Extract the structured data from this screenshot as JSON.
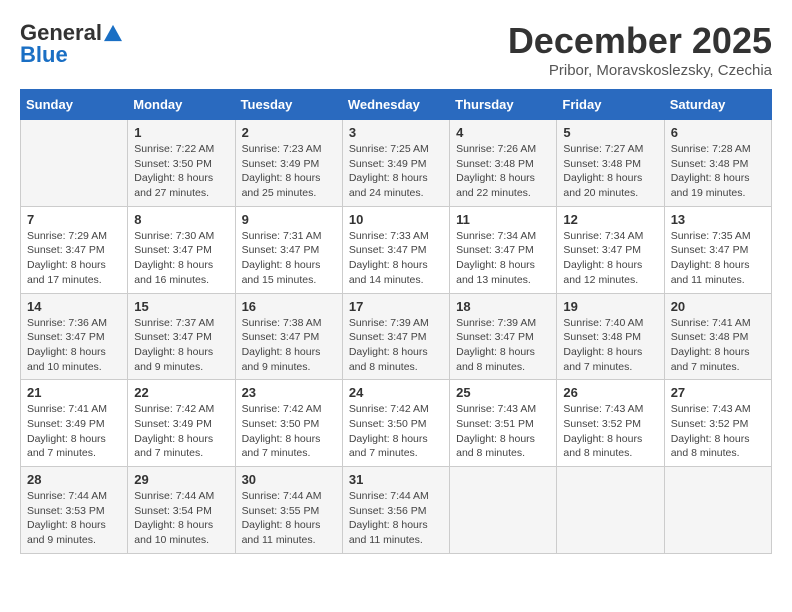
{
  "header": {
    "logo_line1": "General",
    "logo_line2": "Blue",
    "month_title": "December 2025",
    "location": "Pribor, Moravskoslezsky, Czechia"
  },
  "days_of_week": [
    "Sunday",
    "Monday",
    "Tuesday",
    "Wednesday",
    "Thursday",
    "Friday",
    "Saturday"
  ],
  "weeks": [
    [
      {
        "day": "",
        "info": ""
      },
      {
        "day": "1",
        "info": "Sunrise: 7:22 AM\nSunset: 3:50 PM\nDaylight: 8 hours\nand 27 minutes."
      },
      {
        "day": "2",
        "info": "Sunrise: 7:23 AM\nSunset: 3:49 PM\nDaylight: 8 hours\nand 25 minutes."
      },
      {
        "day": "3",
        "info": "Sunrise: 7:25 AM\nSunset: 3:49 PM\nDaylight: 8 hours\nand 24 minutes."
      },
      {
        "day": "4",
        "info": "Sunrise: 7:26 AM\nSunset: 3:48 PM\nDaylight: 8 hours\nand 22 minutes."
      },
      {
        "day": "5",
        "info": "Sunrise: 7:27 AM\nSunset: 3:48 PM\nDaylight: 8 hours\nand 20 minutes."
      },
      {
        "day": "6",
        "info": "Sunrise: 7:28 AM\nSunset: 3:48 PM\nDaylight: 8 hours\nand 19 minutes."
      }
    ],
    [
      {
        "day": "7",
        "info": "Sunrise: 7:29 AM\nSunset: 3:47 PM\nDaylight: 8 hours\nand 17 minutes."
      },
      {
        "day": "8",
        "info": "Sunrise: 7:30 AM\nSunset: 3:47 PM\nDaylight: 8 hours\nand 16 minutes."
      },
      {
        "day": "9",
        "info": "Sunrise: 7:31 AM\nSunset: 3:47 PM\nDaylight: 8 hours\nand 15 minutes."
      },
      {
        "day": "10",
        "info": "Sunrise: 7:33 AM\nSunset: 3:47 PM\nDaylight: 8 hours\nand 14 minutes."
      },
      {
        "day": "11",
        "info": "Sunrise: 7:34 AM\nSunset: 3:47 PM\nDaylight: 8 hours\nand 13 minutes."
      },
      {
        "day": "12",
        "info": "Sunrise: 7:34 AM\nSunset: 3:47 PM\nDaylight: 8 hours\nand 12 minutes."
      },
      {
        "day": "13",
        "info": "Sunrise: 7:35 AM\nSunset: 3:47 PM\nDaylight: 8 hours\nand 11 minutes."
      }
    ],
    [
      {
        "day": "14",
        "info": "Sunrise: 7:36 AM\nSunset: 3:47 PM\nDaylight: 8 hours\nand 10 minutes."
      },
      {
        "day": "15",
        "info": "Sunrise: 7:37 AM\nSunset: 3:47 PM\nDaylight: 8 hours\nand 9 minutes."
      },
      {
        "day": "16",
        "info": "Sunrise: 7:38 AM\nSunset: 3:47 PM\nDaylight: 8 hours\nand 9 minutes."
      },
      {
        "day": "17",
        "info": "Sunrise: 7:39 AM\nSunset: 3:47 PM\nDaylight: 8 hours\nand 8 minutes."
      },
      {
        "day": "18",
        "info": "Sunrise: 7:39 AM\nSunset: 3:47 PM\nDaylight: 8 hours\nand 8 minutes."
      },
      {
        "day": "19",
        "info": "Sunrise: 7:40 AM\nSunset: 3:48 PM\nDaylight: 8 hours\nand 7 minutes."
      },
      {
        "day": "20",
        "info": "Sunrise: 7:41 AM\nSunset: 3:48 PM\nDaylight: 8 hours\nand 7 minutes."
      }
    ],
    [
      {
        "day": "21",
        "info": "Sunrise: 7:41 AM\nSunset: 3:49 PM\nDaylight: 8 hours\nand 7 minutes."
      },
      {
        "day": "22",
        "info": "Sunrise: 7:42 AM\nSunset: 3:49 PM\nDaylight: 8 hours\nand 7 minutes."
      },
      {
        "day": "23",
        "info": "Sunrise: 7:42 AM\nSunset: 3:50 PM\nDaylight: 8 hours\nand 7 minutes."
      },
      {
        "day": "24",
        "info": "Sunrise: 7:42 AM\nSunset: 3:50 PM\nDaylight: 8 hours\nand 7 minutes."
      },
      {
        "day": "25",
        "info": "Sunrise: 7:43 AM\nSunset: 3:51 PM\nDaylight: 8 hours\nand 8 minutes."
      },
      {
        "day": "26",
        "info": "Sunrise: 7:43 AM\nSunset: 3:52 PM\nDaylight: 8 hours\nand 8 minutes."
      },
      {
        "day": "27",
        "info": "Sunrise: 7:43 AM\nSunset: 3:52 PM\nDaylight: 8 hours\nand 8 minutes."
      }
    ],
    [
      {
        "day": "28",
        "info": "Sunrise: 7:44 AM\nSunset: 3:53 PM\nDaylight: 8 hours\nand 9 minutes."
      },
      {
        "day": "29",
        "info": "Sunrise: 7:44 AM\nSunset: 3:54 PM\nDaylight: 8 hours\nand 10 minutes."
      },
      {
        "day": "30",
        "info": "Sunrise: 7:44 AM\nSunset: 3:55 PM\nDaylight: 8 hours\nand 11 minutes."
      },
      {
        "day": "31",
        "info": "Sunrise: 7:44 AM\nSunset: 3:56 PM\nDaylight: 8 hours\nand 11 minutes."
      },
      {
        "day": "",
        "info": ""
      },
      {
        "day": "",
        "info": ""
      },
      {
        "day": "",
        "info": ""
      }
    ]
  ]
}
